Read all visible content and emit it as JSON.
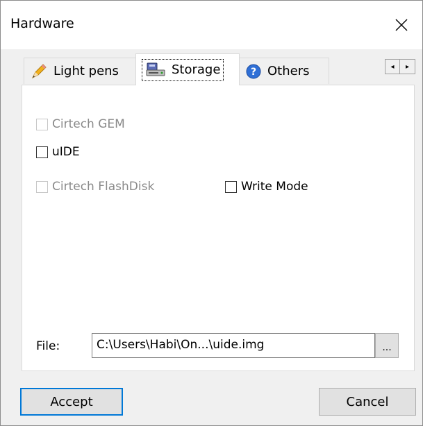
{
  "window": {
    "title": "Hardware"
  },
  "tabs": [
    {
      "label": "Light pens",
      "icon": "pencil-icon"
    },
    {
      "label": "Storage",
      "icon": "storage-device-icon",
      "selected": true
    },
    {
      "label": "Others",
      "icon": "help-circle-icon"
    }
  ],
  "scroller": {
    "left": "◂",
    "right": "▸"
  },
  "storage": {
    "cirtech_gem": {
      "label": "Cirtech GEM",
      "checked": false,
      "enabled": false
    },
    "uide": {
      "label": "uIDE",
      "checked": false,
      "enabled": true
    },
    "cirtech_flashdisk": {
      "label": "Cirtech FlashDisk",
      "checked": false,
      "enabled": false
    },
    "write_mode": {
      "label": "Write Mode",
      "checked": false,
      "enabled": true
    },
    "file": {
      "label": "File:",
      "value": "C:\\Users\\Habi\\On...\\uide.img",
      "browse_label": "..."
    }
  },
  "buttons": {
    "accept": "Accept",
    "cancel": "Cancel"
  },
  "colors": {
    "focus": "#0078d7",
    "disabled_text": "#8a8a8a"
  }
}
